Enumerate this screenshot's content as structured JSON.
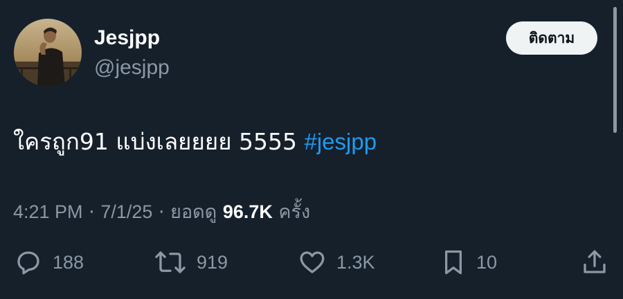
{
  "author": {
    "display_name": "Jesjpp",
    "handle": "@jesjpp"
  },
  "follow_button_label": "ติดตาม",
  "tweet": {
    "text": "ใครถูก91 แบ่งเลยยยย 5555 ",
    "hashtag": "#jesjpp"
  },
  "meta": {
    "time": "4:21 PM",
    "separator": " · ",
    "date": "7/1/25",
    "views_label": "ยอดดู ",
    "views_count": "96.7K",
    "views_unit": " ครั้ง"
  },
  "actions": {
    "reply": {
      "icon": "reply-icon",
      "count": "188"
    },
    "retweet": {
      "icon": "retweet-icon",
      "count": "919"
    },
    "like": {
      "icon": "heart-icon",
      "count": "1.3K"
    },
    "bookmark": {
      "icon": "bookmark-icon",
      "count": "10"
    },
    "share": {
      "icon": "share-icon"
    }
  },
  "colors": {
    "background": "#15202b",
    "primary_text": "#ffffff",
    "secondary_text": "#8b98a5",
    "hashtag": "#1d9bf0",
    "follow_button_bg": "#eff3f4"
  }
}
